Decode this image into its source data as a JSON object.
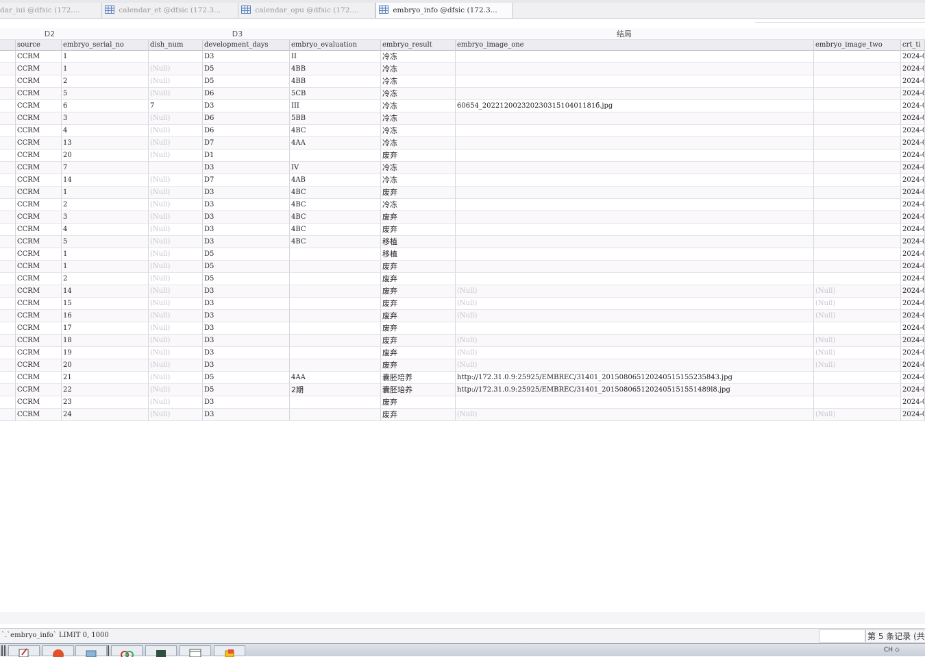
{
  "tabs": [
    {
      "label": "dar_iui @dfsic (172...."
    },
    {
      "label": "calendar_et @dfsic (172.3..."
    },
    {
      "label": "calendar_opu @dfsic (172...."
    },
    {
      "label": "embryo_info @dfsic (172.3..."
    }
  ],
  "active_tab": 3,
  "group_headers": {
    "d2": "D2",
    "d3": "D3",
    "result": "结局"
  },
  "columns": [
    "source",
    "embryo_serial_no",
    "dish_num",
    "development_days",
    "embryo_evaluation",
    "embryo_result",
    "embryo_image_one",
    "embryo_image_two",
    "crt_ti"
  ],
  "rows": [
    [
      "CCRM",
      "1",
      "",
      "D3",
      "II",
      "冷冻",
      "",
      "",
      "2024-0"
    ],
    [
      "CCRM",
      "1",
      "(Null)",
      "D5",
      "4BB",
      "冷冻",
      "",
      "",
      "2024-0"
    ],
    [
      "CCRM",
      "2",
      "(Null)",
      "D5",
      "4BB",
      "冷冻",
      "",
      "",
      "2024-0"
    ],
    [
      "CCRM",
      "5",
      "(Null)",
      "D6",
      "5CB",
      "冷冻",
      "",
      "",
      "2024-0"
    ],
    [
      "CCRM",
      "6",
      "7",
      "D3",
      "III",
      "冷冻",
      "60654_20221200232023031510401181б.jpg",
      "",
      "2024-0"
    ],
    [
      "CCRM",
      "3",
      "(Null)",
      "D6",
      "5BB",
      "冷冻",
      "",
      "",
      "2024-0"
    ],
    [
      "CCRM",
      "4",
      "(Null)",
      "D6",
      "4BC",
      "冷冻",
      "",
      "",
      "2024-0"
    ],
    [
      "CCRM",
      "13",
      "(Null)",
      "D7",
      "4AA",
      "冷冻",
      "",
      "",
      "2024-0"
    ],
    [
      "CCRM",
      "20",
      "(Null)",
      "D1",
      "",
      "废弃",
      "",
      "",
      "2024-0"
    ],
    [
      "CCRM",
      "7",
      "",
      "D3",
      "IV",
      "冷冻",
      "",
      "",
      "2024-0"
    ],
    [
      "CCRM",
      "14",
      "(Null)",
      "D7",
      "4AB",
      "冷冻",
      "",
      "",
      "2024-0"
    ],
    [
      "CCRM",
      "1",
      "(Null)",
      "D3",
      "4BC",
      "废弃",
      "",
      "",
      "2024-0"
    ],
    [
      "CCRM",
      "2",
      "(Null)",
      "D3",
      "4BC",
      "冷冻",
      "",
      "",
      "2024-0"
    ],
    [
      "CCRM",
      "3",
      "(Null)",
      "D3",
      "4BC",
      "废弃",
      "",
      "",
      "2024-0"
    ],
    [
      "CCRM",
      "4",
      "(Null)",
      "D3",
      "4BC",
      "废弃",
      "",
      "",
      "2024-0"
    ],
    [
      "CCRM",
      "5",
      "(Null)",
      "D3",
      "4BC",
      "移植",
      "",
      "",
      "2024-0"
    ],
    [
      "CCRM",
      "1",
      "(Null)",
      "D5",
      "",
      "移植",
      "",
      "",
      "2024-0"
    ],
    [
      "CCRM",
      "1",
      "(Null)",
      "D5",
      "",
      "废弃",
      "",
      "",
      "2024-0"
    ],
    [
      "CCRM",
      "2",
      "(Null)",
      "D5",
      "",
      "废弃",
      "",
      "",
      "2024-0"
    ],
    [
      "CCRM",
      "14",
      "(Null)",
      "D3",
      "",
      "废弃",
      "(Null)",
      "(Null)",
      "2024-0"
    ],
    [
      "CCRM",
      "15",
      "(Null)",
      "D3",
      "",
      "废弃",
      "(Null)",
      "(Null)",
      "2024-0"
    ],
    [
      "CCRM",
      "16",
      "(Null)",
      "D3",
      "",
      "废弃",
      "(Null)",
      "(Null)",
      "2024-0"
    ],
    [
      "CCRM",
      "17",
      "(Null)",
      "D3",
      "",
      "废弃",
      "",
      "",
      "2024-0"
    ],
    [
      "CCRM",
      "18",
      "(Null)",
      "D3",
      "",
      "废弃",
      "(Null)",
      "(Null)",
      "2024-0"
    ],
    [
      "CCRM",
      "19",
      "(Null)",
      "D3",
      "",
      "废弃",
      "(Null)",
      "(Null)",
      "2024-0"
    ],
    [
      "CCRM",
      "20",
      "(Null)",
      "D3",
      "",
      "废弃",
      "(Null)",
      "(Null)",
      "2024-0"
    ],
    [
      "CCRM",
      "21",
      "(Null)",
      "D5",
      "4AA",
      "囊胚培养",
      "http://172.31.0.9:25925/EMBREC/31401_20150806512024051515523584З.jpg",
      "",
      "2024-0"
    ],
    [
      "CCRM",
      "22",
      "(Null)",
      "D5",
      "2期",
      "囊胚培养",
      "http://172.31.0.9:25925/EMBREC/31401_2015080651202405151551489l8.jpg",
      "",
      "2024-0"
    ],
    [
      "CCRM",
      "23",
      "(Null)",
      "D3",
      "",
      "废弃",
      "",
      "",
      "2024-0"
    ],
    [
      "CCRM",
      "24",
      "(Null)",
      "D3",
      "",
      "废弃",
      "(Null)",
      "(Null)",
      "2024-0"
    ]
  ],
  "status": {
    "sql": "`.`embryo_info` LIMIT 0, 1000",
    "records": "第 5 条记录 (共"
  },
  "tray": {
    "text": "CH ◇"
  },
  "colors": {
    "null": "#c3c3cd",
    "header_bg": "#ececf1",
    "alt_row": "#fbf8fb"
  }
}
